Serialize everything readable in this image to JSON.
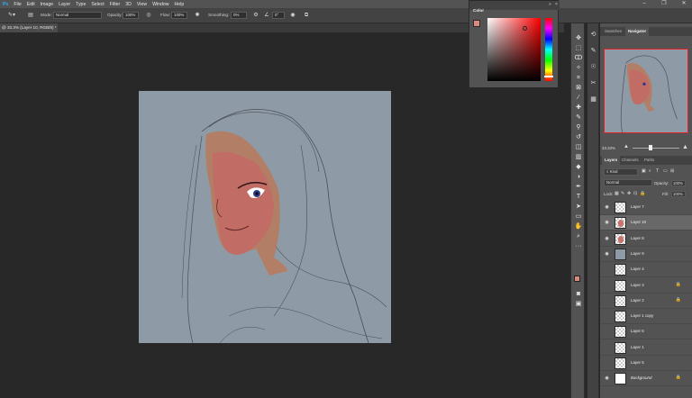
{
  "menu": {
    "items": [
      "File",
      "Edit",
      "Image",
      "Layer",
      "Type",
      "Select",
      "Filter",
      "3D",
      "View",
      "Window",
      "Help"
    ]
  },
  "options": {
    "mode_label": "Mode:",
    "mode_value": "Normal",
    "opacity_label": "Opacity:",
    "opacity_value": "100%",
    "flow_label": "Flow:",
    "flow_value": "100%",
    "smoothing_label": "Smoothing:",
    "smoothing_value": "0%",
    "angle_value": "0°"
  },
  "document": {
    "tab_title": "@ 33.3% (Layer 10, RGB/8) *"
  },
  "color_panel": {
    "title": "Color",
    "foreground": "#d98a7e",
    "background": "#ffffff"
  },
  "navigator": {
    "tabs": [
      "Swatches",
      "Navigator"
    ],
    "zoom": "33.33%"
  },
  "layers_panel": {
    "tabs": [
      "Layers",
      "Channels",
      "Paths"
    ],
    "filter_value": "Kind",
    "blend_mode": "Normal",
    "opacity_label": "Opacity:",
    "opacity_value": "100%",
    "lock_label": "Lock:",
    "fill_label": "Fill:",
    "fill_value": "100%",
    "layers": [
      {
        "name": "Layer 7",
        "visible": true,
        "locked": false
      },
      {
        "name": "Layer 10",
        "visible": true,
        "locked": false
      },
      {
        "name": "Layer 8",
        "visible": true,
        "locked": false
      },
      {
        "name": "Layer 9",
        "visible": true,
        "locked": false
      },
      {
        "name": "Layer 4",
        "visible": false,
        "locked": false
      },
      {
        "name": "Layer 3",
        "visible": false,
        "locked": true
      },
      {
        "name": "Layer 2",
        "visible": false,
        "locked": true
      },
      {
        "name": "Layer 1 copy",
        "visible": false,
        "locked": false
      },
      {
        "name": "Layer 6",
        "visible": false,
        "locked": false
      },
      {
        "name": "Layer 1",
        "visible": false,
        "locked": false
      },
      {
        "name": "Layer 5",
        "visible": false,
        "locked": false
      },
      {
        "name": "Background",
        "visible": true,
        "locked": true
      }
    ]
  },
  "colors": {
    "canvas": "#8e9aa6",
    "skin": "#c8736c",
    "hood_orange": "#c88a5c"
  }
}
